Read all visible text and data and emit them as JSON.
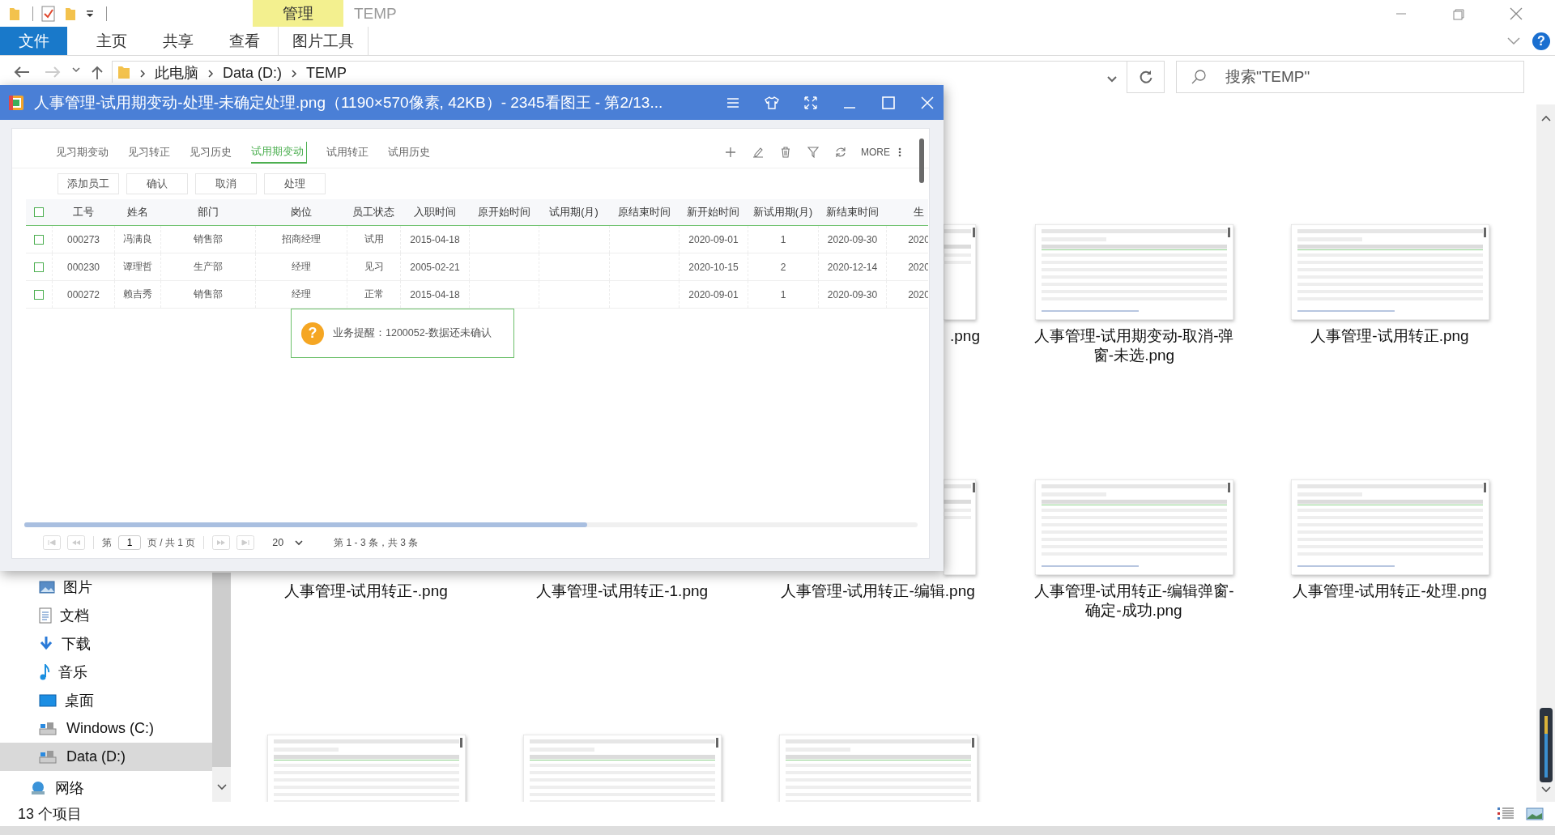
{
  "explorer": {
    "context_group": {
      "label": "管理"
    },
    "window_title": "TEMP",
    "ribbon_tabs": [
      {
        "label": "文件",
        "kind": "file"
      },
      {
        "label": "主页",
        "kind": "tab"
      },
      {
        "label": "共享",
        "kind": "tab"
      },
      {
        "label": "查看",
        "kind": "tab"
      },
      {
        "label": "图片工具",
        "kind": "context"
      }
    ],
    "help": "?",
    "breadcrumbs": [
      "此电脑",
      "Data (D:)",
      "TEMP"
    ],
    "search": {
      "placeholder": "搜索\"TEMP\""
    },
    "nav_items": [
      {
        "label": "图片",
        "kind": "pictures",
        "selected": false
      },
      {
        "label": "文档",
        "kind": "documents",
        "selected": false
      },
      {
        "label": "下载",
        "kind": "downloads",
        "selected": false
      },
      {
        "label": "音乐",
        "kind": "music",
        "selected": false
      },
      {
        "label": "桌面",
        "kind": "desktop",
        "selected": false
      },
      {
        "label": "Windows (C:)",
        "kind": "drive",
        "selected": false
      },
      {
        "label": "Data (D:)",
        "kind": "drive",
        "selected": true
      },
      {
        "label": "网络",
        "kind": "network",
        "selected": false
      }
    ],
    "files": [
      {
        "kind": "hidden"
      },
      {
        "kind": "hidden"
      },
      {
        "kind": "sliver-tail",
        "label": ".png"
      },
      {
        "kind": "full",
        "label": "人事管理-试用期变动-取消-弹窗-未选.png"
      },
      {
        "kind": "full",
        "label": "人事管理-试用转正.png"
      },
      {
        "kind": "label",
        "label": "人事管理-试用转正-.png"
      },
      {
        "kind": "label",
        "label": "人事管理-试用转正-1.png"
      },
      {
        "kind": "sliver",
        "label": "人事管理-试用转正-编辑.png"
      },
      {
        "kind": "full",
        "label": "人事管理-试用转正-编辑弹窗-确定-成功.png"
      },
      {
        "kind": "full",
        "label": "人事管理-试用转正-处理.png"
      },
      {
        "kind": "thumb"
      },
      {
        "kind": "thumb"
      },
      {
        "kind": "thumb"
      }
    ],
    "status": "13 个项目"
  },
  "viewer": {
    "title": "人事管理-试用期变动-处理-未确定处理.png（1190×570像素, 42KB）- 2345看图王 - 第2/13...",
    "tabs": [
      {
        "label": "见习期变动",
        "selected": false
      },
      {
        "label": "见习转正",
        "selected": false
      },
      {
        "label": "见习历史",
        "selected": false
      },
      {
        "label": "试用期变动",
        "selected": true
      },
      {
        "label": "试用转正",
        "selected": false
      },
      {
        "label": "试用历史",
        "selected": false
      }
    ],
    "more": "MORE",
    "buttons": [
      "添加员工",
      "确认",
      "取消",
      "处理"
    ],
    "table": {
      "header_checked": false,
      "columns": [
        "工号",
        "姓名",
        "部门",
        "岗位",
        "员工状态",
        "入职时间",
        "原开始时间",
        "试用期(月)",
        "原结束时间",
        "新开始时间",
        "新试用期(月)",
        "新结束时间",
        "生"
      ],
      "rows": [
        {
          "checked": false,
          "cells": [
            "000273",
            "冯满良",
            "销售部",
            "招商经理",
            "试用",
            "2015-04-18",
            null,
            null,
            null,
            "2020-09-01",
            "1",
            "2020-09-30",
            "2020"
          ]
        },
        {
          "checked": false,
          "cells": [
            "000230",
            "谭理哲",
            "生产部",
            "经理",
            "见习",
            "2005-02-21",
            null,
            null,
            null,
            "2020-10-15",
            "2",
            "2020-12-14",
            "2020"
          ]
        },
        {
          "checked": false,
          "cells": [
            "000272",
            "赖吉秀",
            "销售部",
            "经理",
            "正常",
            "2015-04-18",
            null,
            null,
            null,
            "2020-09-01",
            "1",
            "2020-09-30",
            "2020"
          ]
        }
      ]
    },
    "toast": {
      "mark": "?",
      "text": "业务提醒：1200052-数据还未确认"
    },
    "pagination": {
      "before": "第",
      "page": "1",
      "after": "页 / 共 1 页",
      "page_size": "20",
      "summary": "第 1 - 3 条，共 3 条"
    }
  }
}
